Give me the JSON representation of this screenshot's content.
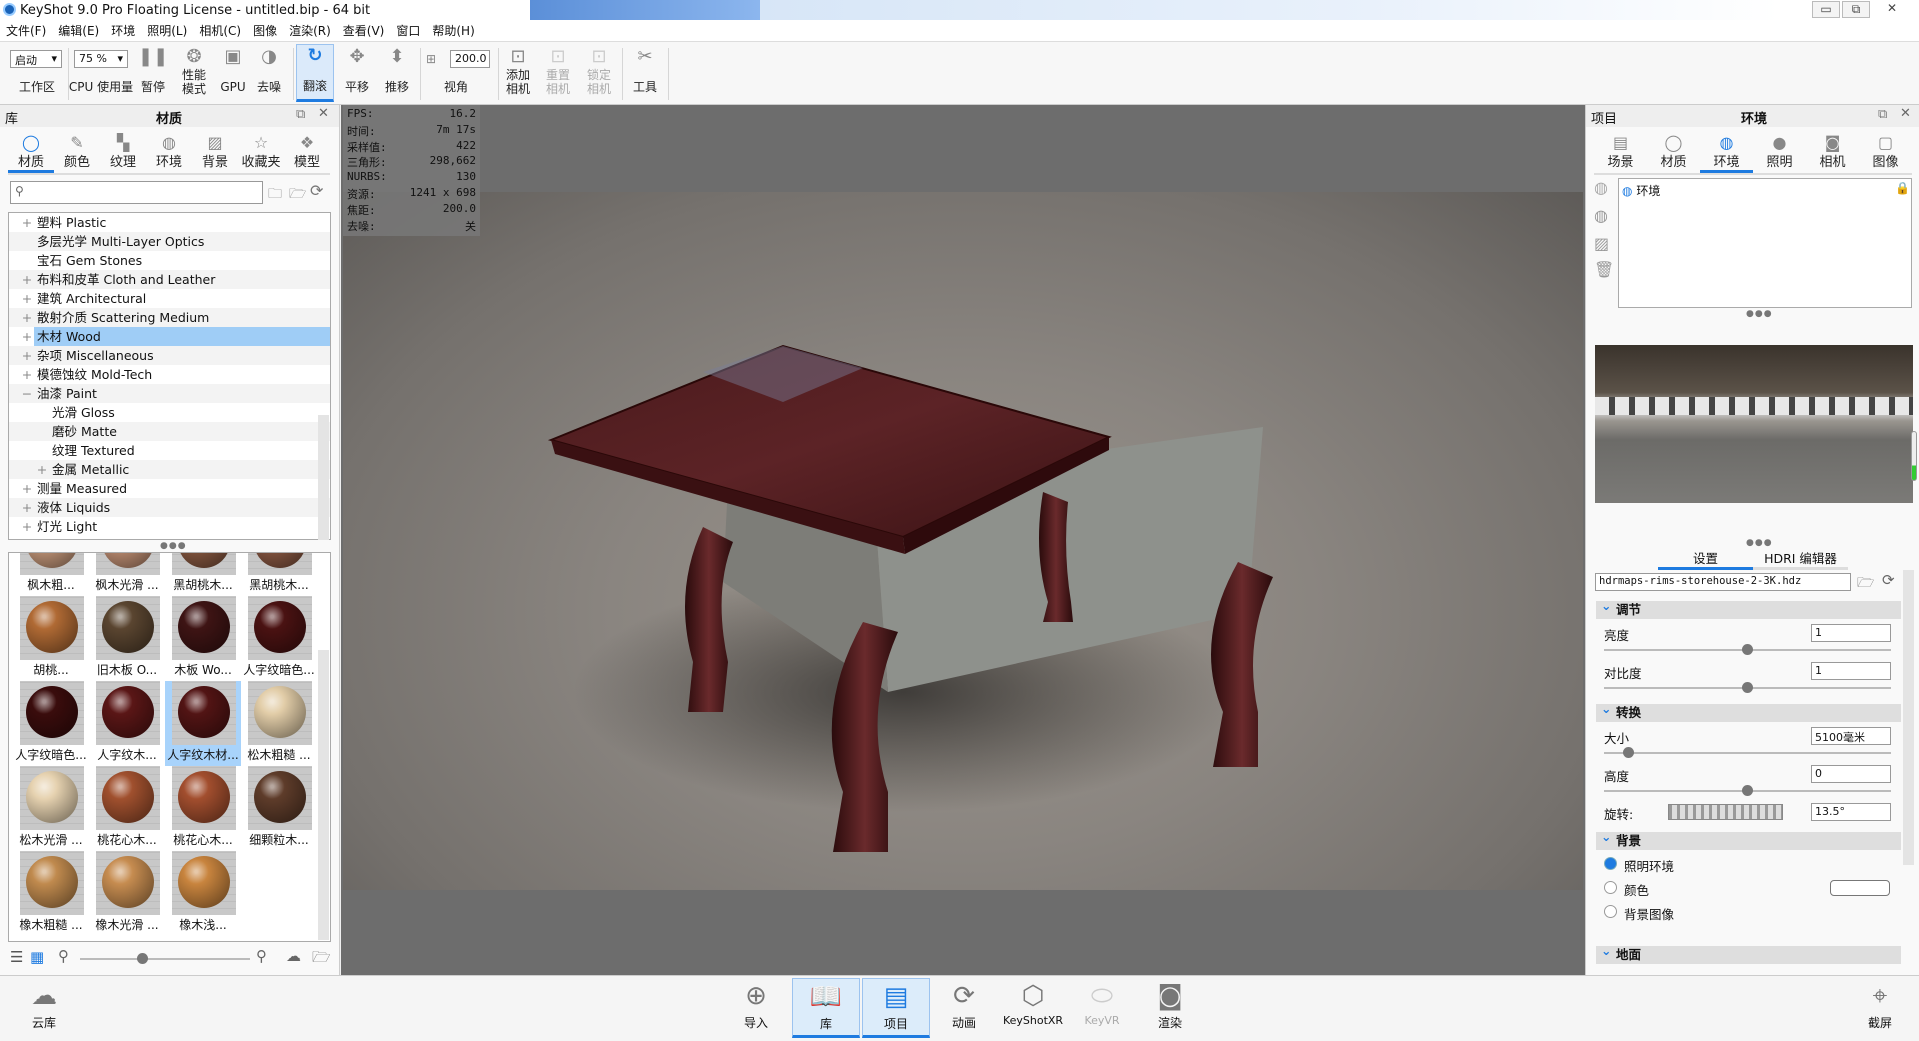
{
  "window": {
    "title": "KeyShot 9.0 Pro Floating License  - untitled.bip  - 64 bit",
    "minimize": "▭",
    "restore": "⧉",
    "close": "✕"
  },
  "menu": [
    "文件(F)",
    "编辑(E)",
    "环境",
    "照明(L)",
    "相机(C)",
    "图像",
    "渲染(R)",
    "查看(V)",
    "窗口",
    "帮助(H)"
  ],
  "toolbar": {
    "workspace_value": "启动",
    "workspace_label": "工作区",
    "cpu_value": "75 %",
    "cpu_label": "CPU 使用量",
    "pause": "暂停",
    "perf_mode": "性能\n模式",
    "gpu": "GPU",
    "denoise": "去噪",
    "tumble": "翻滚",
    "pan": "平移",
    "dolly": "推移",
    "fov_value": "200.0",
    "fov_label": "视角",
    "add_camera": "添加\n相机",
    "reset_camera": "重置\n相机",
    "lock_camera": "锁定\n相机",
    "tools": "工具"
  },
  "library": {
    "title": "库",
    "panel_title": "材质",
    "tabs": [
      {
        "label": "材质",
        "icon": "material-icon",
        "active": true
      },
      {
        "label": "颜色",
        "icon": "color-icon"
      },
      {
        "label": "纹理",
        "icon": "texture-icon"
      },
      {
        "label": "环境",
        "icon": "environment-icon"
      },
      {
        "label": "背景",
        "icon": "background-icon"
      },
      {
        "label": "收藏夹",
        "icon": "favorites-icon"
      },
      {
        "label": "模型",
        "icon": "model-icon"
      }
    ],
    "search_placeholder": "",
    "tree": [
      {
        "label": "塑料 Plastic",
        "expander": "+",
        "level": 0
      },
      {
        "label": "多层光学 Multi-Layer Optics",
        "expander": "",
        "level": 0
      },
      {
        "label": "宝石 Gem Stones",
        "expander": "",
        "level": 0
      },
      {
        "label": "布料和皮革 Cloth and Leather",
        "expander": "+",
        "level": 0
      },
      {
        "label": "建筑 Architectural",
        "expander": "+",
        "level": 0
      },
      {
        "label": "散射介质 Scattering Medium",
        "expander": "+",
        "level": 0
      },
      {
        "label": "木材 Wood",
        "expander": "+",
        "level": 0,
        "selected": true
      },
      {
        "label": "杂项 Miscellaneous",
        "expander": "+",
        "level": 0
      },
      {
        "label": "模德蚀纹 Mold-Tech",
        "expander": "+",
        "level": 0
      },
      {
        "label": "油漆 Paint",
        "expander": "−",
        "level": 0
      },
      {
        "label": "光滑 Gloss",
        "expander": "",
        "level": 1
      },
      {
        "label": "磨砂 Matte",
        "expander": "",
        "level": 1
      },
      {
        "label": "纹理 Textured",
        "expander": "",
        "level": 1
      },
      {
        "label": "金属 Metallic",
        "expander": "+",
        "level": 1
      },
      {
        "label": "测量 Measured",
        "expander": "+",
        "level": 0
      },
      {
        "label": "液体 Liquids",
        "expander": "+",
        "level": 0
      },
      {
        "label": "灯光 Light",
        "expander": "+",
        "level": 0
      }
    ],
    "materials": [
      {
        "name": "枫木粗...",
        "color": "#c89a7c"
      },
      {
        "name": "枫木光滑 ...",
        "color": "#c49276"
      },
      {
        "name": "黑胡桃木...",
        "color": "#8a5a42"
      },
      {
        "name": "黑胡桃木...",
        "color": "#8c5a44"
      },
      {
        "name": "胡桃...",
        "color": "#b06a34"
      },
      {
        "name": "旧木板 O...",
        "color": "#5a4530"
      },
      {
        "name": "木板 Wo...",
        "color": "#3e1414"
      },
      {
        "name": "人字纹暗色...",
        "color": "#4a1212"
      },
      {
        "name": "人字纹暗色...",
        "color": "#3a0c0c"
      },
      {
        "name": "人字纹木...",
        "color": "#5a1616"
      },
      {
        "name": "人字纹木材...",
        "color": "#521414",
        "selected": true
      },
      {
        "name": "松木粗糙 ...",
        "color": "#e2cda8"
      },
      {
        "name": "松木光滑 ...",
        "color": "#e6d2b0"
      },
      {
        "name": "桃花心木...",
        "color": "#a0502e"
      },
      {
        "name": "桃花心木...",
        "color": "#a24e2e"
      },
      {
        "name": "细颗粒木...",
        "color": "#5e3c2a"
      },
      {
        "name": "橡木粗糙 ...",
        "color": "#c08a4e"
      },
      {
        "name": "橡木光滑 ...",
        "color": "#c68c50"
      },
      {
        "name": "橡木浅...",
        "color": "#c8843e"
      }
    ],
    "cloud_library": "云库"
  },
  "viewport": {
    "hud": [
      {
        "k": "FPS:",
        "v": "16.2"
      },
      {
        "k": "时间:",
        "v": "7m 17s"
      },
      {
        "k": "采样值:",
        "v": "422"
      },
      {
        "k": "三角形:",
        "v": "298,662"
      },
      {
        "k": "NURBS:",
        "v": "130"
      },
      {
        "k": "资源:",
        "v": "1241 x 698"
      },
      {
        "k": "焦距:",
        "v": "200.0"
      },
      {
        "k": "去噪:",
        "v": "关"
      }
    ]
  },
  "project": {
    "title": "项目",
    "panel_title": "环境",
    "tabs": [
      {
        "label": "场景",
        "icon": "scene-icon"
      },
      {
        "label": "材质",
        "icon": "material-icon"
      },
      {
        "label": "环境",
        "icon": "environment-icon",
        "active": true
      },
      {
        "label": "照明",
        "icon": "lighting-icon"
      },
      {
        "label": "相机",
        "icon": "camera-icon"
      },
      {
        "label": "图像",
        "icon": "image-icon"
      }
    ],
    "env_list": [
      "环境"
    ],
    "subtabs": [
      "设置",
      "HDRI 编辑器"
    ],
    "hdri_file": "hdrmaps-rims-storehouse-2-3K.hdz",
    "sections": {
      "adjust": {
        "title": "调节",
        "brightness_label": "亮度",
        "brightness": "1",
        "brightness_level": 0.5,
        "contrast_label": "对比度",
        "contrast": "1",
        "contrast_level": 0.5
      },
      "transform": {
        "title": "转换",
        "size_label": "大小",
        "size": "5100毫米",
        "size_level": 0.07,
        "height_label": "高度",
        "height": "0",
        "height_level": 0.5,
        "rotation_label": "旋转:",
        "rotation": "13.5°"
      },
      "background": {
        "title": "背景",
        "options": [
          "照明环境",
          "颜色",
          "背景图像"
        ],
        "selected": 0,
        "color": "#ffffff"
      },
      "ground": {
        "title": "地面"
      }
    }
  },
  "bottom": {
    "import": "导入",
    "library": "库",
    "project": "项目",
    "animation": "动画",
    "keyshotxr": "KeyShotXR",
    "keyvr": "KeyVR",
    "render": "渲染",
    "screenshot": "截屏"
  }
}
